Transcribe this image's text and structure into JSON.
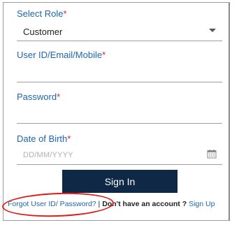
{
  "form": {
    "role": {
      "label": "Select Role",
      "required_mark": "*",
      "value": "Customer"
    },
    "userid": {
      "label": "User ID/Email/Mobile",
      "required_mark": "*",
      "value": ""
    },
    "password": {
      "label": "Password",
      "required_mark": "*",
      "value": ""
    },
    "dob": {
      "label": "Date of Birth",
      "required_mark": "*",
      "placeholder": "DD/MM/YYYY"
    },
    "signin_label": "Sign In"
  },
  "footer": {
    "forgot_label": "Forgot User ID/ Password?",
    "separator": " | ",
    "no_account_text": "Don't have an account ?",
    "signup_label": "Sign Up"
  },
  "colors": {
    "label_blue": "#1e66b0",
    "required_red": "#d9262c",
    "button_navy": "#0e2846",
    "annotation_red": "#e11a1a"
  }
}
